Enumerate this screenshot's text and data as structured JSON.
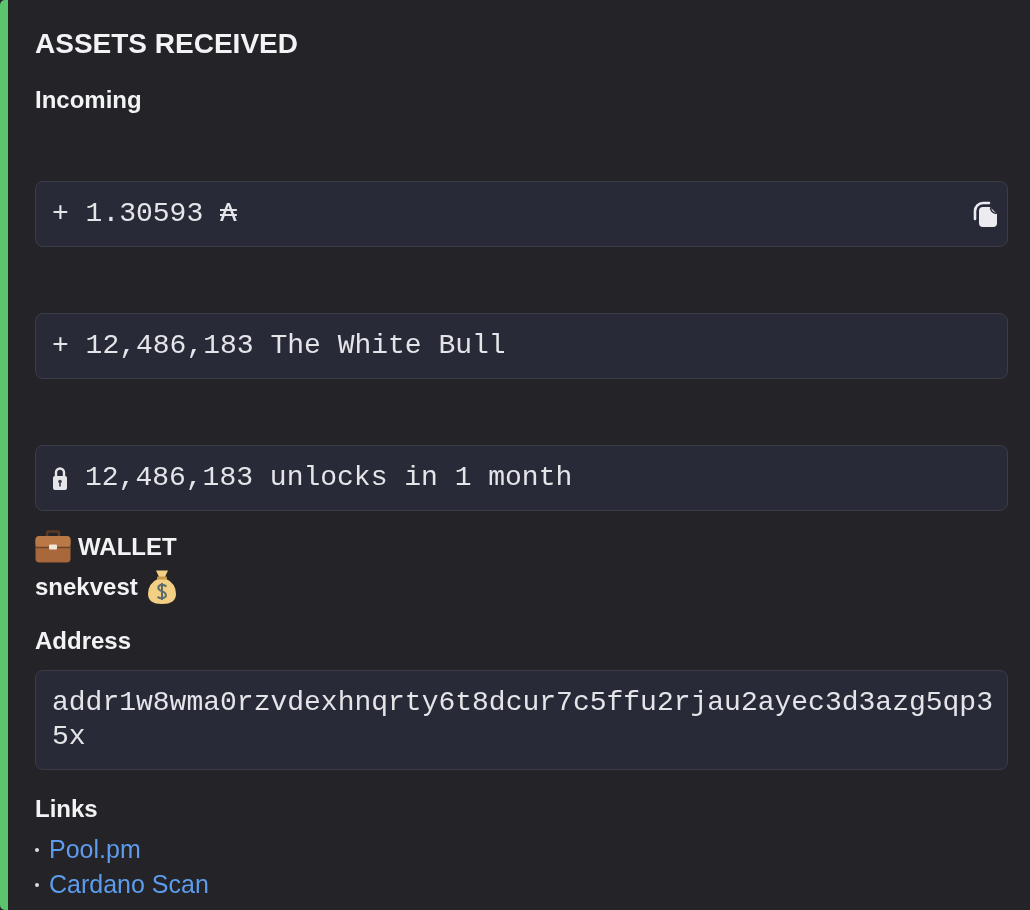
{
  "title": "ASSETS RECEIVED",
  "incoming": {
    "label": "Incoming",
    "blocks": [
      {
        "kind": "amount",
        "text": "+ 1.30593 ₳",
        "copy_button": true
      },
      {
        "kind": "amount",
        "text": "+ 12,486,183 The White Bull",
        "copy_button": false
      },
      {
        "kind": "locked",
        "text": "12,486,183 unlocks in 1 month",
        "copy_button": false
      }
    ]
  },
  "wallet": {
    "heading": "WALLET",
    "name": "snekvest"
  },
  "address": {
    "label": "Address",
    "value": "addr1w8wma0rzvdexhnqrty6t8dcur7c5ffu2rjau2ayec3d3azg5qp35x"
  },
  "links": {
    "heading": "Links",
    "items": [
      "Pool.pm",
      "Cardano Scan"
    ]
  }
}
